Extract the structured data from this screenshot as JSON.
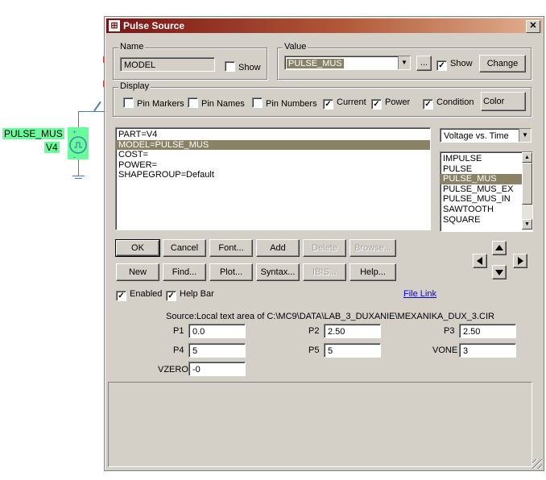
{
  "schematic": {
    "part_label": "PULSE_MUS",
    "ref_label": "V4",
    "plus": "+",
    "minus": "-"
  },
  "dialog": {
    "title": "Pulse Source",
    "close": "✕",
    "name_group": {
      "label": "Name",
      "value": "MODEL",
      "show_label": "Show",
      "show_checked": false
    },
    "value_group": {
      "label": "Value",
      "value": "PULSE_MUS",
      "ellipsis": "...",
      "show_label": "Show",
      "show_checked": true,
      "change_label": "Change"
    },
    "display_group": {
      "label": "Display",
      "items": [
        {
          "label": "Pin Markers",
          "checked": false
        },
        {
          "label": "Pin Names",
          "checked": false
        },
        {
          "label": "Pin Numbers",
          "checked": false
        },
        {
          "label": "Current",
          "checked": true
        },
        {
          "label": "Power",
          "checked": true
        },
        {
          "label": "Condition",
          "checked": true
        }
      ],
      "color_label": "Color"
    },
    "attributes": [
      "PART=V4",
      "MODEL=PULSE_MUS",
      "COST=",
      "POWER=",
      "SHAPEGROUP=Default"
    ],
    "selected_attribute": 1,
    "plot_select": "Voltage vs. Time",
    "models": [
      "IMPULSE",
      "PULSE",
      "PULSE_MUS",
      "PULSE_MUS_EX",
      "PULSE_MUS_IN",
      "SAWTOOTH",
      "SQUARE"
    ],
    "selected_model": 2,
    "buttons_row1": [
      {
        "label": "OK",
        "enabled": true
      },
      {
        "label": "Cancel",
        "enabled": true
      },
      {
        "label": "Font...",
        "enabled": true
      },
      {
        "label": "Add",
        "enabled": true
      },
      {
        "label": "Delete",
        "enabled": false
      },
      {
        "label": "Browse...",
        "enabled": false
      }
    ],
    "buttons_row2": [
      {
        "label": "New",
        "enabled": true
      },
      {
        "label": "Find...",
        "enabled": true
      },
      {
        "label": "Plot...",
        "enabled": true
      },
      {
        "label": "Syntax...",
        "enabled": true
      },
      {
        "label": "IBIS...",
        "enabled": false
      },
      {
        "label": "Help...",
        "enabled": true
      }
    ],
    "enabled_label": "Enabled",
    "enabled_checked": true,
    "helpbar_label": "Help Bar",
    "helpbar_checked": true,
    "file_link": "File Link",
    "source_text": "Source:Local text area of C:\\MC9\\DATA\\LAB_3_DUXANIE\\MEXANIKA_DUX_3.CIR",
    "params": {
      "P1": "0.0",
      "P2": "2.50",
      "P3": "2.50",
      "P4": "5",
      "P5": "5",
      "VONE": "3",
      "VZERO": "-0"
    },
    "param_labels": {
      "P1": "P1",
      "P2": "P2",
      "P3": "P3",
      "P4": "P4",
      "P5": "P5",
      "VONE": "VONE",
      "VZERO": "VZERO"
    }
  },
  "colors": {
    "title_start": "#7a1414",
    "selection": "#8a8266",
    "schematic_label_bg": "#66ff99",
    "link": "#0000ff"
  }
}
